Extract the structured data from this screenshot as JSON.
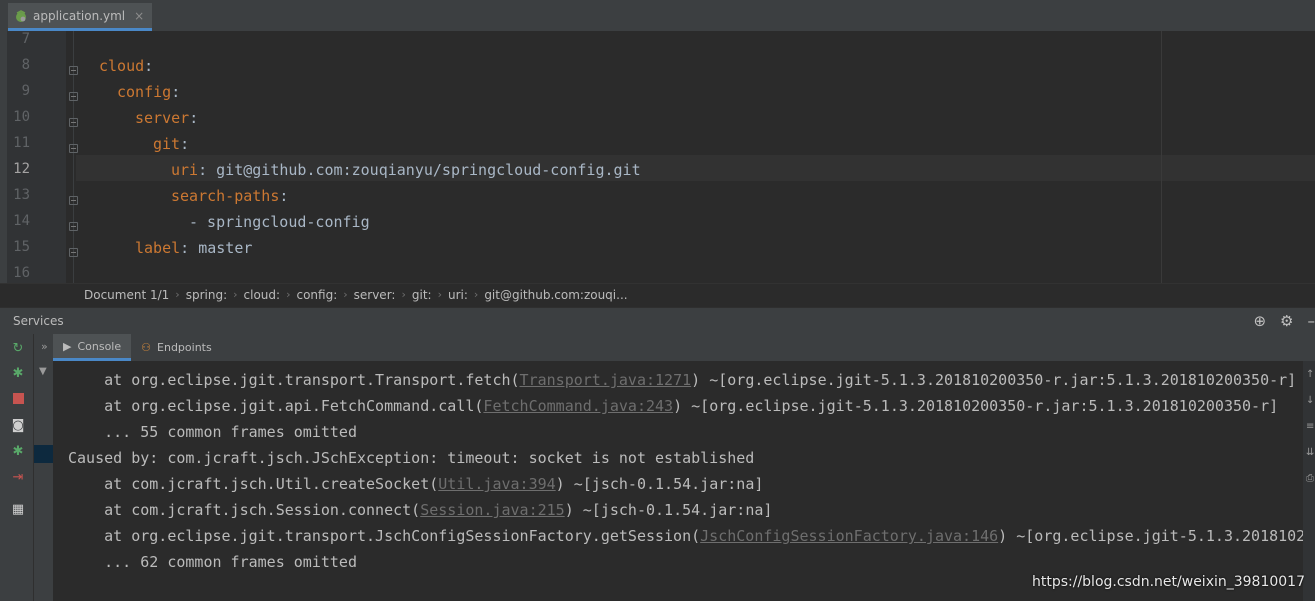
{
  "editor_tab": {
    "filename": "application.yml",
    "close": "×"
  },
  "editor": {
    "line_numbers": [
      "7",
      "8",
      "9",
      "10",
      "11",
      "12",
      "13",
      "14",
      "15",
      "16"
    ],
    "lines": [
      {
        "key": "",
        "val": ""
      },
      {
        "key": "cloud",
        "val": ""
      },
      {
        "key": "config",
        "val": ""
      },
      {
        "key": "server",
        "val": ""
      },
      {
        "key": "git",
        "val": ""
      },
      {
        "key": "uri",
        "val": " git@github.com:zouqianyu/springcloud-config.git"
      },
      {
        "key": "search-paths",
        "val": ""
      },
      {
        "key": "",
        "val": "- springcloud-config"
      },
      {
        "key": "label",
        "val": " master"
      },
      {
        "key": "",
        "val": ""
      }
    ]
  },
  "breadcrumbs": [
    "Document 1/1",
    "spring:",
    "cloud:",
    "config:",
    "server:",
    "git:",
    "uri:",
    "git@github.com:zouqi..."
  ],
  "services": {
    "title": "Services"
  },
  "console_tabs": [
    {
      "label": "Console",
      "icon": "console-icon"
    },
    {
      "label": "Endpoints",
      "icon": "endpoints-icon"
    }
  ],
  "console": {
    "lines": [
      {
        "pre": "    at org.eclipse.jgit.transport.Transport.fetch(",
        "link": "Transport.java:1271",
        "post": ") ~[org.eclipse.jgit-5.1.3.201810200350-r.jar:5.1.3.201810200350-r]"
      },
      {
        "pre": "    at org.eclipse.jgit.api.FetchCommand.call(",
        "link": "FetchCommand.java:243",
        "post": ") ~[org.eclipse.jgit-5.1.3.201810200350-r.jar:5.1.3.201810200350-r]"
      },
      {
        "pre": "    ... 55 common frames omitted",
        "link": "",
        "post": ""
      },
      {
        "pre": "Caused by: com.jcraft.jsch.JSchException: timeout: socket is not established",
        "link": "",
        "post": ""
      },
      {
        "pre": "    at com.jcraft.jsch.Util.createSocket(",
        "link": "Util.java:394",
        "post": ") ~[jsch-0.1.54.jar:na]"
      },
      {
        "pre": "    at com.jcraft.jsch.Session.connect(",
        "link": "Session.java:215",
        "post": ") ~[jsch-0.1.54.jar:na]"
      },
      {
        "pre": "    at org.eclipse.jgit.transport.JschConfigSessionFactory.getSession(",
        "link": "JschConfigSessionFactory.java:146",
        "post": ") ~[org.eclipse.jgit-5.1.3.2018102"
      },
      {
        "pre": "    ... 62 common frames omitted",
        "link": "",
        "post": ""
      }
    ]
  },
  "watermark": "https://blog.csdn.net/weixin_39810017",
  "colors": {
    "accent": "#4a88c7",
    "yaml_key": "#cc7832",
    "background": "#2b2b2b"
  }
}
